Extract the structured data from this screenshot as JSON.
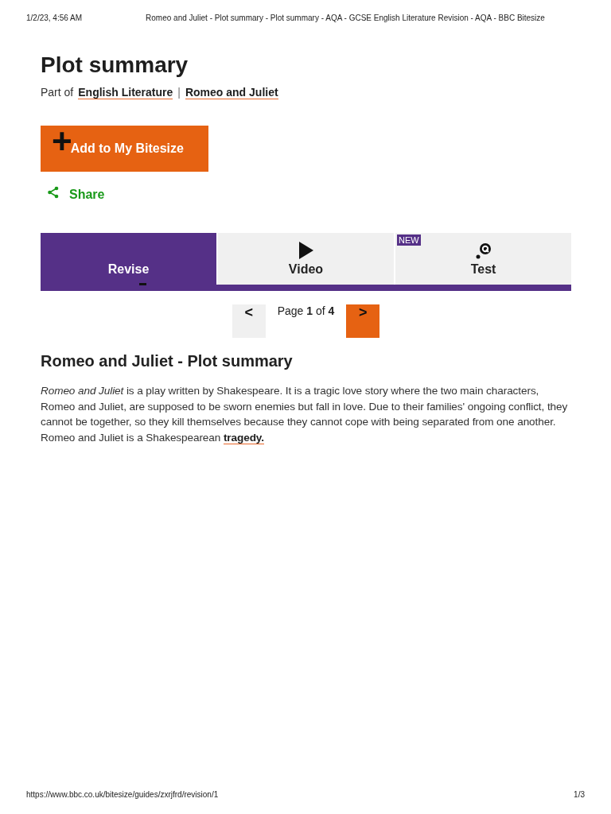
{
  "print_header": {
    "date": "1/2/23, 4:56 AM",
    "title": "Romeo and Juliet - Plot summary - Plot summary - AQA - GCSE English Literature Revision - AQA - BBC Bitesize"
  },
  "page_title": "Plot summary",
  "breadcrumb": {
    "prefix": "Part of",
    "links": [
      "English Literature",
      "Romeo and Juliet"
    ],
    "separator": "|"
  },
  "add_button": {
    "icon": "+",
    "label": "Add to My Bitesize"
  },
  "share": {
    "label": "Share"
  },
  "tabs": [
    {
      "label": "Revise",
      "kind": "text",
      "selected": true
    },
    {
      "label": "Video",
      "kind": "play",
      "selected": false
    },
    {
      "label": "Test",
      "kind": "quiz",
      "selected": false,
      "badge": "NEW"
    }
  ],
  "pager": {
    "prev": "<",
    "text": "Page **1** of **4**",
    "next": ">"
  },
  "section_heading": "Romeo and Juliet - Plot summary",
  "paragraph": {
    "text": "*Romeo and Juliet* is a play written by Shakespeare. It is a tragic love story where the two main characters, Romeo and Juliet, are supposed to be sworn enemies but fall in love. Due to their families' ongoing conflict, they cannot be together, so they kill themselves because they cannot cope with being separated from one another. Romeo and Juliet is a Shakespearean",
    "link": "tragedy."
  },
  "print_footer": {
    "url": "https://www.bbc.co.uk/bitesize/guides/zxrjfrd/revision/1",
    "page": "1/3"
  }
}
